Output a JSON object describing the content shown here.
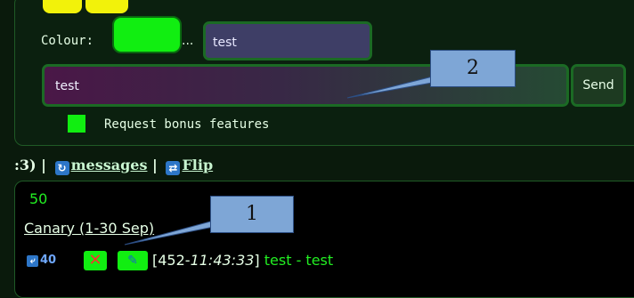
{
  "form": {
    "colour_label": "Colour:",
    "colour_value": "#11ee11",
    "ellipsis": "...",
    "name_value": "test",
    "message_value": "test",
    "send_label": "Send",
    "bonus_label": "Request bonus features",
    "bonus_checked": true
  },
  "nav": {
    "prefix": ":3) |",
    "messages_label": "messages",
    "separator": "|",
    "flip_label": "Flip"
  },
  "list": {
    "count": "50",
    "canary_label": "Canary (1-30 Sep)",
    "row": {
      "reply_count": "40",
      "open_bracket": "[452-",
      "time": "11:43:33",
      "close_bracket": "]",
      "body": " test - test"
    }
  },
  "callouts": [
    {
      "label": "1"
    },
    {
      "label": "2"
    }
  ],
  "icons": {
    "reply": "reply-icon",
    "delete": "close-icon",
    "edit": "pencil-icon",
    "refresh": "refresh-icon",
    "flip": "flip-icon"
  },
  "colors": {
    "accent_green": "#11ee11",
    "panel_border": "#1f5a26",
    "callout_fill": "#7ea6d6"
  }
}
